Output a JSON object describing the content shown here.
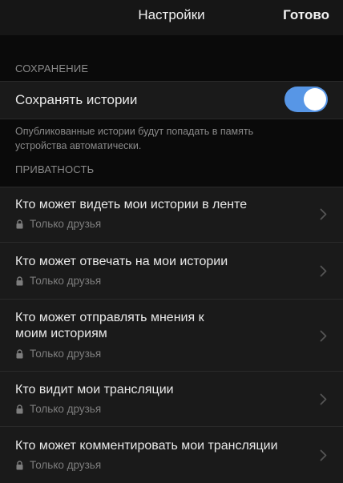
{
  "header": {
    "title": "Настройки",
    "done_label": "Готово"
  },
  "sections": {
    "saving": {
      "header": "СОХРАНЕНИЕ",
      "toggle_label": "Сохранять истории",
      "toggle_on": true,
      "description_line1": "Опубликованные истории будут попадать в память",
      "description_line2": "устройства автоматически."
    },
    "privacy": {
      "header": "ПРИВАТНОСТЬ",
      "items": [
        {
          "title": "Кто может видеть мои истории в ленте",
          "value": "Только друзья"
        },
        {
          "title": "Кто может отвечать на мои истории",
          "value": "Только друзья"
        },
        {
          "title_line1": "Кто может отправлять мнения к",
          "title_line2": "моим историям",
          "value": "Только друзья"
        },
        {
          "title": "Кто видит мои трансляции",
          "value": "Только друзья"
        },
        {
          "title": "Кто может комментировать мои трансляции",
          "value": "Только друзья"
        }
      ]
    }
  },
  "colors": {
    "background": "#0a0a0a",
    "row_background": "#1a1a1a",
    "toggle_accent": "#5796e6"
  },
  "icons": {
    "lock": "lock-icon",
    "chevron": "chevron-right-icon"
  }
}
